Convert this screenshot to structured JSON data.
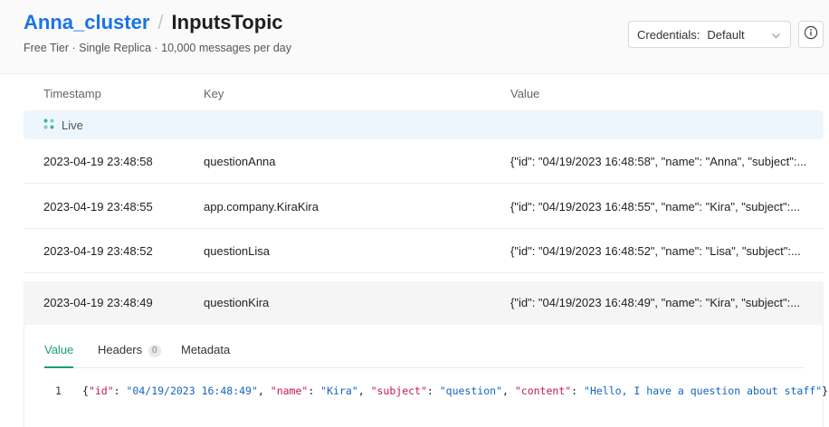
{
  "header": {
    "cluster": "Anna_cluster",
    "separator": "/",
    "topic": "InputsTopic",
    "subtitle": "Free Tier · Single Replica · 10,000 messages per day",
    "credentials_label": "Credentials:",
    "credentials_value": "Default"
  },
  "table": {
    "columns": {
      "timestamp": "Timestamp",
      "key": "Key",
      "value": "Value"
    },
    "live_label": "Live",
    "rows": [
      {
        "timestamp": "2023-04-19 23:48:58",
        "key": "questionAnna",
        "value": "{\"id\": \"04/19/2023 16:48:58\", \"name\": \"Anna\", \"subject\":..."
      },
      {
        "timestamp": "2023-04-19 23:48:55",
        "key": "app.company.KiraKira",
        "value": "{\"id\": \"04/19/2023 16:48:55\", \"name\": \"Kira\", \"subject\":..."
      },
      {
        "timestamp": "2023-04-19 23:48:52",
        "key": "questionLisa",
        "value": "{\"id\": \"04/19/2023 16:48:52\", \"name\": \"Lisa\", \"subject\":..."
      },
      {
        "timestamp": "2023-04-19 23:48:49",
        "key": "questionKira",
        "value": "{\"id\": \"04/19/2023 16:48:49\", \"name\": \"Kira\", \"subject\":..."
      }
    ]
  },
  "detail": {
    "tabs": {
      "value": "Value",
      "headers": "Headers",
      "headers_count": "0",
      "metadata": "Metadata"
    },
    "line_number": "1",
    "json": {
      "open": "{",
      "k1": "\"id\"",
      "v1": "\"04/19/2023 16:48:49\"",
      "k2": "\"name\"",
      "v2": "\"Kira\"",
      "k3": "\"subject\"",
      "v3": "\"question\"",
      "k4": "\"content\"",
      "v4": "\"Hello, I have a question about staff\"",
      "colon": ": ",
      "comma": ", ",
      "close": "}"
    }
  },
  "colors": {
    "accent_blue": "#1a73e8",
    "accent_green": "#1a9e7a",
    "live_dot": "#36b39b"
  }
}
